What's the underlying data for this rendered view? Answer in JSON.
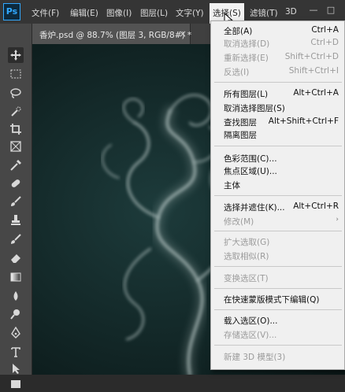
{
  "app": {
    "logo_text": "Ps"
  },
  "menubar": {
    "items": [
      "文件(F)",
      "编辑(E)",
      "图像(I)",
      "图层(L)",
      "文字(Y)",
      "选择(S)",
      "滤镜(T)",
      "3D"
    ],
    "active_index": 5
  },
  "window_controls": {
    "minimize": "—",
    "restore": "□"
  },
  "document_tab": {
    "title": "香炉.psd @ 88.7% (图层 3, RGB/8#) *",
    "close": "×"
  },
  "tools": [
    "move-icon",
    "marquee-icon",
    "lasso-icon",
    "quick-select-icon",
    "crop-icon",
    "frame-icon",
    "eyedropper-icon",
    "healing-brush-icon",
    "brush-icon",
    "clone-stamp-icon",
    "history-brush-icon",
    "eraser-icon",
    "gradient-icon",
    "blur-icon",
    "dodge-icon",
    "pen-icon",
    "type-icon",
    "path-select-icon",
    "rectangle-icon"
  ],
  "select_menu": {
    "items": [
      {
        "label": "全部(A)",
        "shortcut": "Ctrl+A",
        "enabled": true
      },
      {
        "label": "取消选择(D)",
        "shortcut": "Ctrl+D",
        "enabled": false
      },
      {
        "label": "重新选择(E)",
        "shortcut": "Shift+Ctrl+D",
        "enabled": false
      },
      {
        "label": "反选(I)",
        "shortcut": "Shift+Ctrl+I",
        "enabled": false
      },
      {
        "separator": true
      },
      {
        "label": "所有图层(L)",
        "shortcut": "Alt+Ctrl+A",
        "enabled": true
      },
      {
        "label": "取消选择图层(S)",
        "shortcut": "",
        "enabled": true
      },
      {
        "label": "查找图层",
        "shortcut": "Alt+Shift+Ctrl+F",
        "enabled": true
      },
      {
        "label": "隔离图层",
        "shortcut": "",
        "enabled": true
      },
      {
        "separator": true
      },
      {
        "label": "色彩范围(C)...",
        "shortcut": "",
        "enabled": true
      },
      {
        "label": "焦点区域(U)...",
        "shortcut": "",
        "enabled": true
      },
      {
        "label": "主体",
        "shortcut": "",
        "enabled": true
      },
      {
        "separator": true
      },
      {
        "label": "选择并遮住(K)...",
        "shortcut": "Alt+Ctrl+R",
        "enabled": true
      },
      {
        "label": "修改(M)",
        "shortcut": "",
        "enabled": false,
        "submenu": true
      },
      {
        "separator": true
      },
      {
        "label": "扩大选取(G)",
        "shortcut": "",
        "enabled": false
      },
      {
        "label": "选取相似(R)",
        "shortcut": "",
        "enabled": false
      },
      {
        "separator": true
      },
      {
        "label": "变换选区(T)",
        "shortcut": "",
        "enabled": false
      },
      {
        "separator": true
      },
      {
        "label": "在快速蒙版模式下编辑(Q)",
        "shortcut": "",
        "enabled": true
      },
      {
        "separator": true
      },
      {
        "label": "载入选区(O)...",
        "shortcut": "",
        "enabled": true
      },
      {
        "label": "存储选区(V)...",
        "shortcut": "",
        "enabled": false
      },
      {
        "separator": true
      },
      {
        "label": "新建 3D 模型(3)",
        "shortcut": "",
        "enabled": false
      }
    ],
    "submenu_arrow": "›"
  },
  "colors": {
    "menu_bg": "#f0f0f0",
    "disabled_text": "#9a9a9a",
    "app_bg": "#353535",
    "accent": "#31a8ff"
  }
}
